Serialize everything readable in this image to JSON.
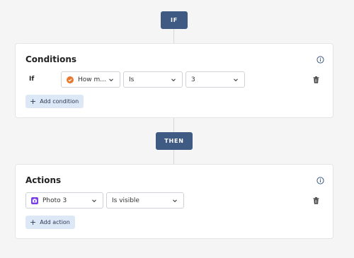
{
  "flow": {
    "if_badge": "IF",
    "then_badge": "THEN"
  },
  "conditions": {
    "title": "Conditions",
    "row_label": "If",
    "question_field": "How m...",
    "operator_field": "Is",
    "value_field": "3",
    "add_button": "Add condition"
  },
  "actions": {
    "title": "Actions",
    "target_field": "Photo 3",
    "action_field": "Is visible",
    "add_button": "Add action"
  },
  "colors": {
    "badge": "#3f5b84",
    "add_button_bg": "#dde8f7",
    "question_icon": "#e8772e",
    "photo_icon": "#7b3fe4"
  },
  "icons": {
    "info": "info-circle-icon",
    "chevron": "chevron-down-icon",
    "trash": "trash-icon",
    "plus": "plus-icon",
    "question": "check-circle-icon",
    "photo": "camera-icon"
  }
}
